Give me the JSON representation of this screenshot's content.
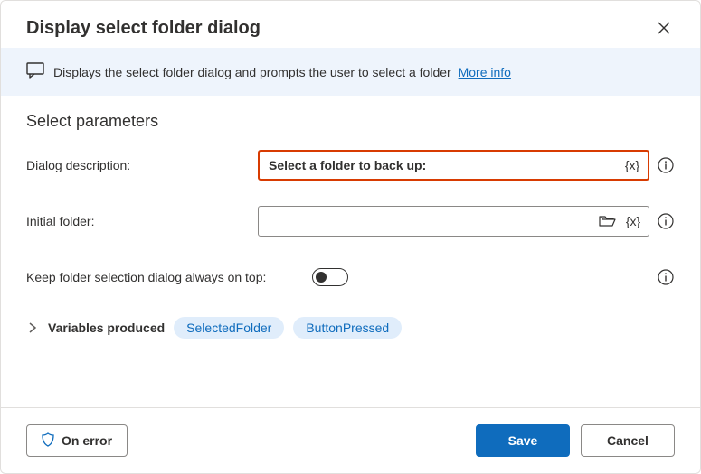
{
  "header": {
    "title": "Display select folder dialog"
  },
  "infoBar": {
    "text": "Displays the select folder dialog and prompts the user to select a folder",
    "moreInfoLabel": "More info"
  },
  "section": {
    "title": "Select parameters"
  },
  "fields": {
    "description": {
      "label": "Dialog description:",
      "value": "Select a folder to back up:"
    },
    "initialFolder": {
      "label": "Initial folder:",
      "value": ""
    },
    "alwaysOnTop": {
      "label": "Keep folder selection dialog always on top:",
      "value": false
    }
  },
  "variables": {
    "label": "Variables produced",
    "items": [
      "SelectedFolder",
      "ButtonPressed"
    ]
  },
  "footer": {
    "onError": "On error",
    "save": "Save",
    "cancel": "Cancel"
  }
}
